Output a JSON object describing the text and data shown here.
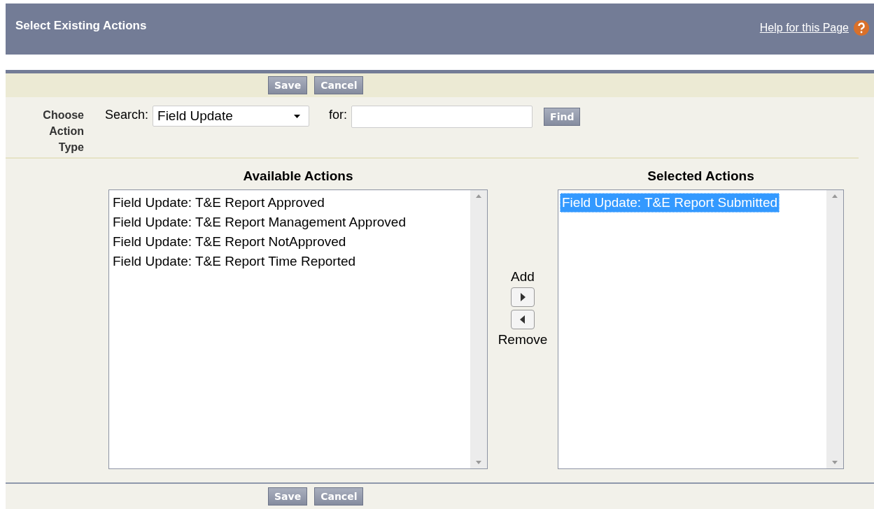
{
  "header": {
    "title": "Select Existing Actions",
    "help_link": "Help for this Page"
  },
  "top_buttons": [
    "Save",
    "Cancel"
  ],
  "search": {
    "choose_label": "Choose Action Type",
    "search_label": "Search:",
    "type_value": "Field Update",
    "for_label": "for:",
    "find_button": "Find"
  },
  "available": {
    "heading": "Available Actions",
    "items": [
      {
        "label": "Field Update: T&E Report Approved",
        "selected": false
      },
      {
        "label": "Field Update: T&E Report Management Approved",
        "selected": false
      },
      {
        "label": "Field Update: T&E Report NotApproved",
        "selected": false
      },
      {
        "label": "Field Update: T&E Report Time Reported",
        "selected": false
      }
    ]
  },
  "mover": {
    "add_label": "Add",
    "remove_label": "Remove"
  },
  "selected_list": {
    "heading": "Selected Actions",
    "items": [
      {
        "label": "Field Update: T&E Report Submitted",
        "selected": true
      }
    ]
  },
  "bottom_buttons": [
    "Save",
    "Cancel"
  ]
}
